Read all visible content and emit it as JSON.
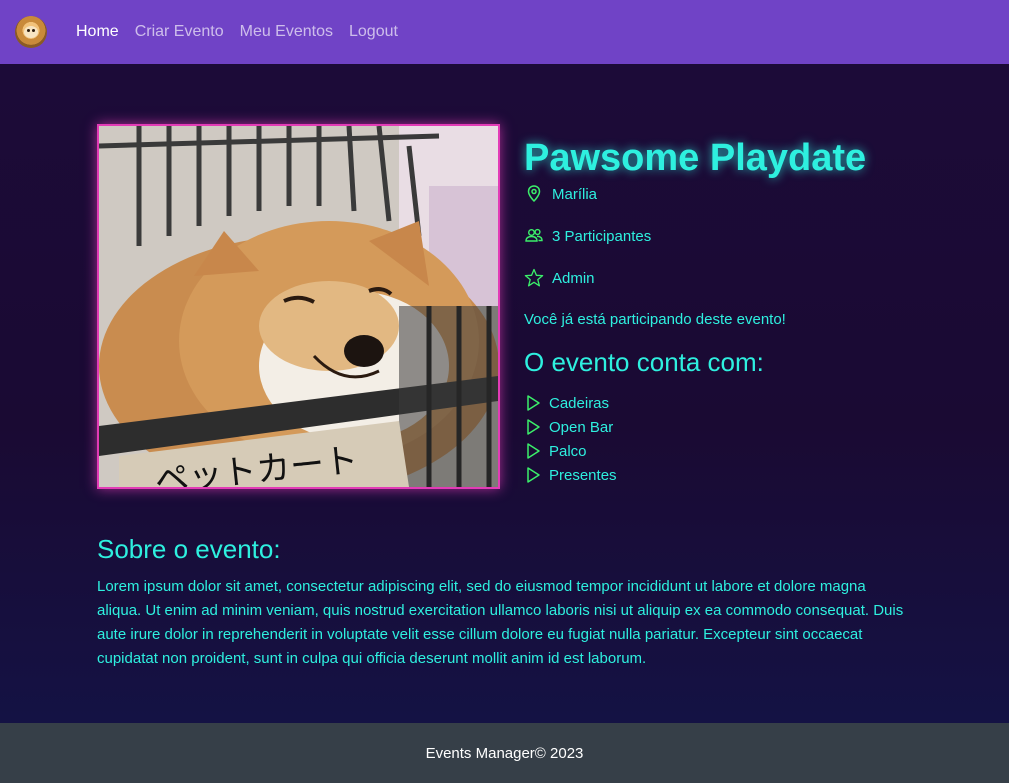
{
  "navbar": {
    "links": [
      {
        "label": "Home"
      },
      {
        "label": "Criar Evento"
      },
      {
        "label": "Meu Eventos"
      },
      {
        "label": "Logout"
      }
    ]
  },
  "event": {
    "title": "Pawsome Playdate",
    "location": "Marília",
    "participants": "3 Participantes",
    "owner": "Admin",
    "status": "Você já está participando deste evento!",
    "image_caption": "ペットカート",
    "features_title": "O evento conta com:",
    "features": [
      "Cadeiras",
      "Open Bar",
      "Palco",
      "Presentes"
    ],
    "about_title": "Sobre o evento:",
    "about_text": "Lorem ipsum dolor sit amet, consectetur adipiscing elit, sed do eiusmod tempor incididunt ut labore et dolore magna aliqua. Ut enim ad minim veniam, quis nostrud exercitation ullamco laboris nisi ut aliquip ex ea commodo consequat. Duis aute irure dolor in reprehenderit in voluptate velit esse cillum dolore eu fugiat nulla pariatur. Excepteur sint occaecat cupidatat non proident, sunt in culpa qui officia deserunt mollit anim id est laborum."
  },
  "footer": {
    "text": "Events Manager© 2023"
  },
  "colors": {
    "navbar": "#7043c6",
    "accent_text": "#2ef0df",
    "icon_green": "#3bef6a",
    "image_border": "#e23bb6",
    "footer": "#363f48"
  }
}
